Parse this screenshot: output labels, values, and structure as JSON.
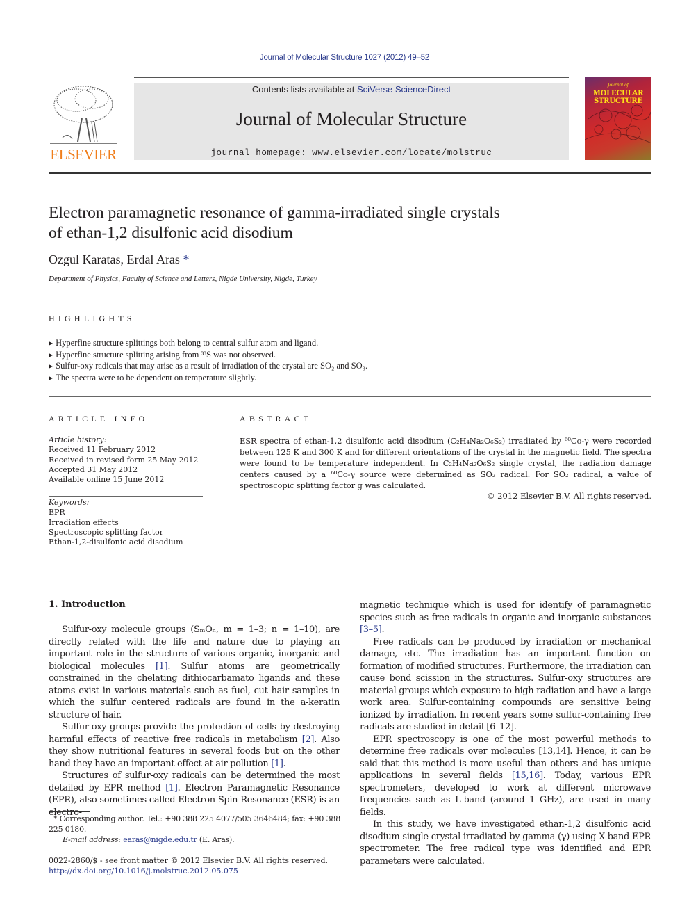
{
  "header": {
    "journal_ref": "Journal of Molecular Structure 1027 (2012) 49–52",
    "contents_prefix": "Contents lists available at ",
    "contents_link": "SciVerse ScienceDirect",
    "journal_name": "Journal of Molecular Structure",
    "homepage_prefix": "journal homepage: ",
    "homepage_url": "www.elsevier.com/locate/molstruc",
    "publisher_logo_text": "ELSEVIER",
    "cover_small": "Journal of",
    "cover_title_line1": "MOLECULAR",
    "cover_title_line2": "STRUCTURE",
    "colors": {
      "link": "#2a3a8c",
      "elsevier_orange": "#f07e1b",
      "band_gray": "#e6e6e6"
    }
  },
  "article": {
    "title_line1": "Electron paramagnetic resonance of gamma-irradiated single crystals",
    "title_line2": "of ethan-1,2 disulfonic acid disodium",
    "authors": "Ozgul Karatas, Erdal Aras",
    "author_mark": "*",
    "affiliation": "Department of Physics, Faculty of Science and Letters, Nigde University, Nigde, Turkey"
  },
  "highlights": {
    "heading": "HIGHLIGHTS",
    "items": [
      "Hyperfine structure splittings both belong to central sulfur atom and ligand.",
      "Hyperfine structure splitting arising from ³³S was not observed.",
      "Sulfur-oxy radicals that may arise as a result of irradiation of the crystal are SO₂ and SO₃.",
      "The spectra were to be dependent on temperature slightly."
    ]
  },
  "article_info": {
    "heading": "ARTICLE INFO",
    "history_label": "Article history:",
    "history": [
      "Received 11 February 2012",
      "Received in revised form 25 May 2012",
      "Accepted 31 May 2012",
      "Available online 15 June 2012"
    ],
    "keywords_label": "Keywords:",
    "keywords": [
      "EPR",
      "Irradiation effects",
      "Spectroscopic splitting factor",
      "Ethan-1,2-disulfonic acid disodium"
    ]
  },
  "abstract": {
    "heading": "ABSTRACT",
    "text": "ESR spectra of ethan-1,2 disulfonic acid disodium (C₂H₄Na₂O₆S₂) irradiated by ⁶⁰Co-γ were recorded between 125 K and 300 K and for different orientations of the crystal in the magnetic field. The spectra were found to be temperature independent. In C₂H₄Na₂O₆S₂ single crystal, the radiation damage centers caused by a ⁶⁰Co-γ source were determined as SO₂ radical. For SO₂ radical, a value of spectroscopic splitting factor g was calculated.",
    "copyright": "© 2012 Elsevier B.V. All rights reserved."
  },
  "body": {
    "intro_heading": "1. Introduction",
    "left": {
      "p1": "Sulfur-oxy molecule groups (SₘOₙ, m = 1–3; n = 1–10), are directly related with the life and nature due to playing an important role in the structure of various organic, inorganic and biological molecules ",
      "p1_ref": "[1]",
      "p1_cont": ". Sulfur atoms are geometrically constrained in the chelating dithiocarbamato ligands and these atoms exist in various materials such as fuel, cut hair samples in which the sulfur centered radicals are found in the a-keratin structure of hair.",
      "p2": "Sulfur-oxy groups provide the protection of cells by destroying harmful effects of reactive free radicals in metabolism ",
      "p2_ref": "[2]",
      "p2_cont": ". Also they show nutritional features in several foods but on the other hand they have an important effect at air pollution ",
      "p2_ref2": "[1]",
      "p2_end": ".",
      "p3": "Structures of sulfur-oxy radicals can be determined the most detailed by EPR method ",
      "p3_ref": "[1]",
      "p3_cont": ". Electron Paramagnetic Resonance (EPR), also sometimes called Electron Spin Resonance (ESR) is an electro-"
    },
    "right": {
      "p0": "magnetic technique which is used for identify of paramagnetic species such as free radicals in organic and inorganic substances ",
      "p0_ref": "[3–5]",
      "p0_end": ".",
      "p1": "Free radicals can be produced by irradiation or mechanical damage, etc. The irradiation has an important function on formation of modified structures. Furthermore, the irradiation can cause bond scission in the structures. Sulfur-oxy structures are material groups which exposure to high radiation and have a large work area. Sulfur-containing compounds are sensitive being ionized by irradiation. In recent years some sulfur-containing free radicals are studied in detail [6–12].",
      "p2": "EPR spectroscopy is one of the most powerful methods to determine free radicals over molecules [13,14]. Hence, it can be said that this method is more useful than others and has unique applications in several fields ",
      "p2_ref": "[15,16]",
      "p2_cont": ". Today, various EPR spectrometers, developed to work at different microwave frequencies such as L-band (around 1 GHz), are used in many fields.",
      "p3": "In this study, we have investigated ethan-1,2 disulfonic acid disodium single crystal irradiated by gamma (γ) using X-band EPR spectrometer. The free radical type was identified and EPR parameters were calculated."
    }
  },
  "footnote": {
    "mark": "*",
    "corresponding": " Corresponding author. Tel.: +90 388 225 4077/505 3646484; fax: +90 388 225 0180.",
    "email_label": "E-mail address: ",
    "email": "earas@nigde.edu.tr",
    "email_suffix": " (E. Aras).",
    "front_matter": "0022-2860/$ - see front matter © 2012 Elsevier B.V. All rights reserved.",
    "doi": "http://dx.doi.org/10.1016/j.molstruc.2012.05.075"
  }
}
